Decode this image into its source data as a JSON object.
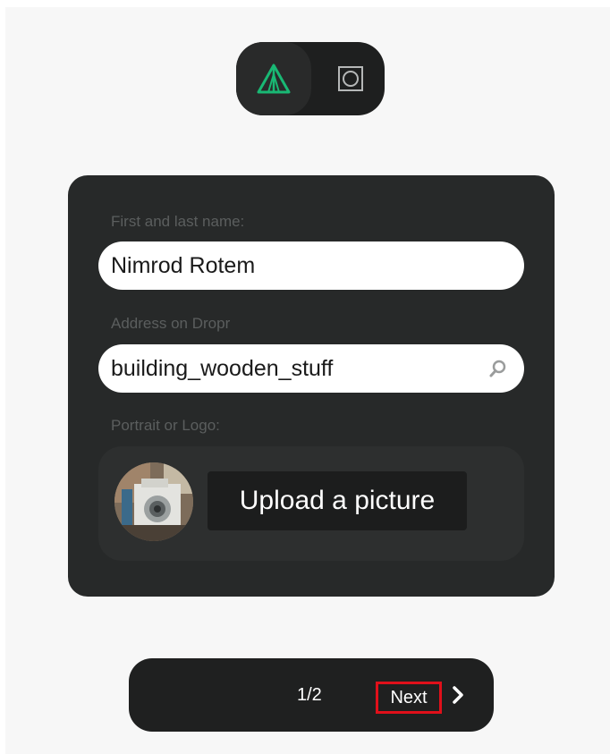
{
  "mode_toggle": {
    "left_icon": "triangle-logo-icon",
    "right_icon": "square-circle-icon",
    "accent_color": "#19b874"
  },
  "form": {
    "name_label": "First and last name:",
    "name_value": "Nimrod Rotem",
    "address_label": "Address on Dropr",
    "address_value": "building_wooden_stuff",
    "portrait_label": "Portrait or Logo:",
    "upload_button": "Upload a picture"
  },
  "footer": {
    "page_indicator": "1/2",
    "next_label": "Next",
    "next_icon": "chevron-right-icon"
  }
}
